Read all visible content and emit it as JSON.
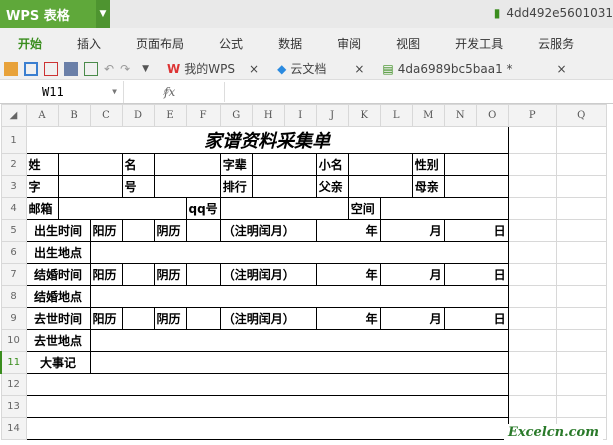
{
  "app": {
    "brand": "WPS 表格",
    "doc_title": "4dd492e5601031"
  },
  "menu": [
    "开始",
    "插入",
    "页面布局",
    "公式",
    "数据",
    "审阅",
    "视图",
    "开发工具",
    "云服务"
  ],
  "tabs": [
    {
      "label": "我的WPS"
    },
    {
      "label": "云文档"
    },
    {
      "label": "4da6989bc5baa1 *"
    }
  ],
  "formula": {
    "cell_ref": "W11",
    "fx": "fx",
    "value": ""
  },
  "columns": [
    "A",
    "B",
    "C",
    "D",
    "E",
    "F",
    "G",
    "H",
    "I",
    "J",
    "K",
    "L",
    "M",
    "N",
    "O",
    "P",
    "Q"
  ],
  "rows": [
    "1",
    "2",
    "3",
    "4",
    "5",
    "6",
    "7",
    "8",
    "9",
    "10",
    "11",
    "12",
    "13",
    "14"
  ],
  "sheet": {
    "title": "家谱资料采集单",
    "r2": [
      "姓",
      "名",
      "字辈",
      "小名",
      "性别"
    ],
    "r3": [
      "字",
      "号",
      "排行",
      "父亲",
      "母亲"
    ],
    "r4": [
      "邮箱",
      "qq号",
      "空间"
    ],
    "r5": [
      "出生时间",
      "阳历",
      "阴历",
      "（注明闰月）",
      "年",
      "月",
      "日"
    ],
    "r6": [
      "出生地点"
    ],
    "r7": [
      "结婚时间",
      "阳历",
      "阴历",
      "（注明闰月）",
      "年",
      "月",
      "日"
    ],
    "r8": [
      "结婚地点"
    ],
    "r9": [
      "去世时间",
      "阳历",
      "阴历",
      "（注明闰月）",
      "年",
      "月",
      "日"
    ],
    "r10": [
      "去世地点"
    ],
    "r11": [
      "大事记"
    ]
  },
  "watermark": "Excelcn.com"
}
